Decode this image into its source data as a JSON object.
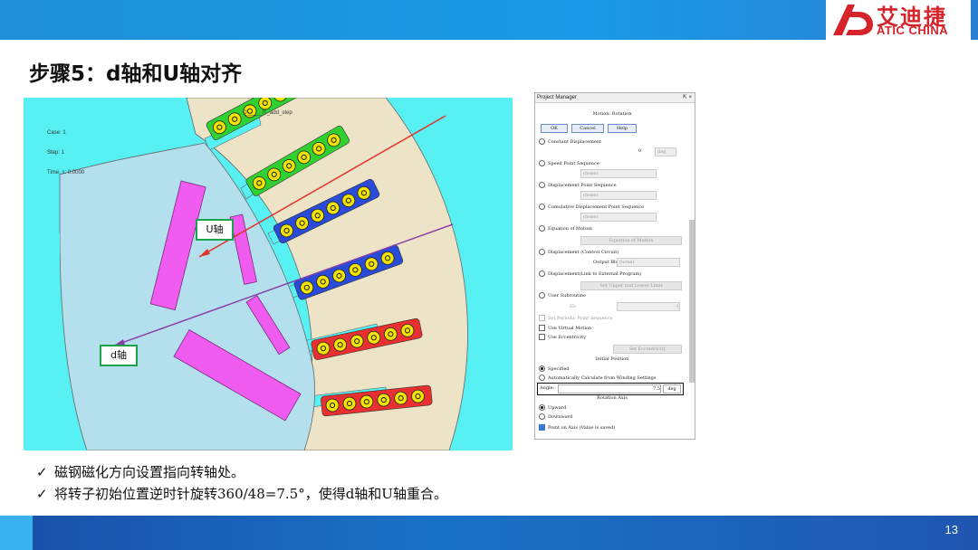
{
  "header": {
    "logo_cn": "艾迪捷",
    "logo_en": "ATIC CHINA"
  },
  "slide": {
    "title": "步骤5：d轴和U轴对齐",
    "page_number": "13"
  },
  "simulation": {
    "caption": "Q_____IT_add_step",
    "case": "Case: 1",
    "step": "Step: 1",
    "time": "Time, s: 0.0000",
    "u_axis_label": "U轴",
    "d_axis_label": "d轴",
    "colors": {
      "background": "#57f1f4",
      "stator": "#ede4c8",
      "rotor": "#b4e0ee",
      "magnet": "#f05cf0",
      "u_axis_arrow": "#e2332a",
      "d_axis_arrow": "#8a3fa8"
    }
  },
  "project_manager": {
    "title": "Project Manager",
    "pin_icon": "pin-icon",
    "close_icon": "close-icon",
    "section_title": "Motion: Rotation",
    "ok": "OK",
    "cancel": "Cancel",
    "help": "Help",
    "options": [
      {
        "label": "Constant Displacement",
        "selected": false
      },
      {
        "label": "Speed Point Sequence",
        "selected": false
      },
      {
        "label": "Displacement Point Sequence",
        "selected": false
      },
      {
        "label": "Cumulative Displacement Point Sequence",
        "selected": false
      },
      {
        "label": "Equation of Motion",
        "selected": false
      },
      {
        "label": "Displacement (Control Circuit)",
        "selected": false
      },
      {
        "label": "Displacement(Link to External Program)",
        "selected": false
      },
      {
        "label": "User Subroutine",
        "selected": false
      }
    ],
    "constant_value": "0",
    "unit_deg": "deg",
    "none_value": "(none)",
    "equation_btn": "Equation of Motion",
    "output_block_label": "Output Block",
    "limits_btn": "Set Upper and Lower Limit",
    "id_label": "ID:",
    "id_value": "-1",
    "periodic_label": "Set Periodic Point Sequence",
    "virtual_motion": "Use Virtual Motion",
    "eccentricity": "Use Eccentricity",
    "eccentricity_btn": "Set Eccentricity",
    "initial_position": "Initial Position",
    "specified": "Specified",
    "auto_calc": "Automatically Calculate from Winding Settings",
    "angle_label": "Angle:",
    "angle_value": "7.5",
    "rotation_axis": "Rotation Axis",
    "upward": "Upward",
    "downward": "Downward",
    "point_on_axis": "Point on Axis (Value is saved)"
  },
  "bullets": [
    "磁钢磁化方向设置指向转轴处。",
    "将转子初始位置逆时针旋转360/48=7.5°，使得d轴和U轴重合。"
  ]
}
